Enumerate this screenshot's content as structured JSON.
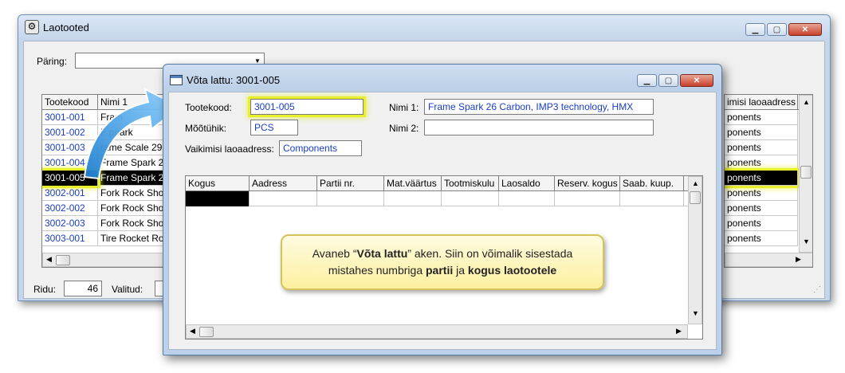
{
  "main_window": {
    "title": "Laotooted",
    "query_label": "Päring:",
    "query_value": "",
    "columns": [
      "Tootekood",
      "Nimi 1"
    ],
    "right_column": "imisi laoaadress",
    "rows": [
      {
        "code": "3001-001",
        "name": "Fram",
        "addr": "ponents"
      },
      {
        "code": "3001-002",
        "name": "F      ppark",
        "addr": "ponents"
      },
      {
        "code": "3001-003",
        "name": "rame Scale 29",
        "addr": "ponents"
      },
      {
        "code": "3001-004",
        "name": "Frame Spark 26",
        "addr": "ponents"
      },
      {
        "code": "3001-005",
        "name": "Frame Spark 26",
        "addr": "ponents"
      },
      {
        "code": "3002-001",
        "name": "Fork Rock Sho",
        "addr": "ponents"
      },
      {
        "code": "3002-002",
        "name": "Fork Rock Sho",
        "addr": "ponents"
      },
      {
        "code": "3002-003",
        "name": "Fork Rock Sho",
        "addr": "ponents"
      },
      {
        "code": "3003-001",
        "name": "Tire Rocket Ro",
        "addr": "ponents"
      }
    ],
    "status": {
      "rows_label": "Ridu:",
      "rows_value": "46",
      "selected_label": "Valitud:"
    }
  },
  "dialog": {
    "title": "Võta lattu: 3001-005",
    "product_code_label": "Tootekood:",
    "product_code": "3001-005",
    "unit_label": "Mõõtühik:",
    "unit": "PCS",
    "default_address_label": "Vaikimisi laoaadress:",
    "default_address": "Components",
    "name1_label": "Nimi 1:",
    "name1": "Frame Spark 26 Carbon, IMP3 technology, HMX",
    "name2_label": "Nimi 2:",
    "name2": "",
    "columns": [
      "Kogus",
      "Aadress",
      "Partii nr.",
      "Mat.väärtus",
      "Tootmiskulu",
      "Laosaldo",
      "Reserv. kogus",
      "Saab. kuup."
    ]
  },
  "callout": {
    "line1_a": "Avaneb “",
    "line1_b": "Võta lattu",
    "line1_c": "” aken. Siin on võimalik sisestada",
    "line2_a": "mistahes numbriga ",
    "line2_b": "partii",
    "line2_c": " ja ",
    "line2_d": "kogus laotootele"
  },
  "colors": {
    "link_blue": "#1a3dc7",
    "highlight": "#e8f02c",
    "arrow": "#3a9be0"
  },
  "icons": [
    "app-icon",
    "dialog-icon",
    "minimize-icon",
    "maximize-icon",
    "close-icon",
    "dropdown-arrow-icon",
    "curved-arrow-icon",
    "resize-grip-icon"
  ]
}
